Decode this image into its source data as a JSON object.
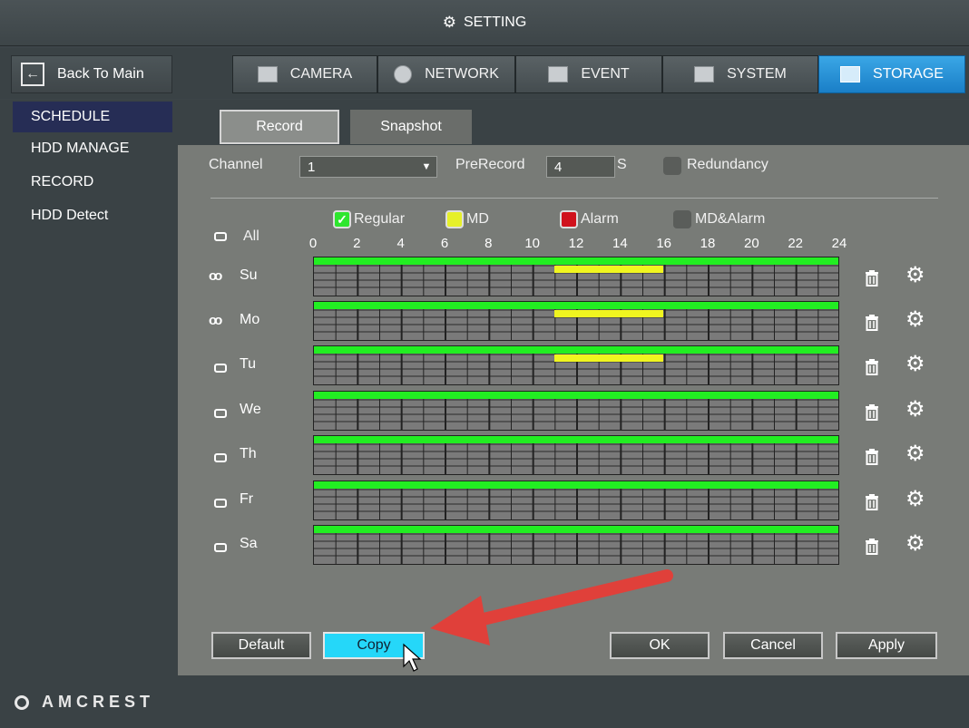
{
  "title": "SETTING",
  "nav": {
    "back_label": "Back To Main",
    "tabs": [
      {
        "label": "CAMERA",
        "icon": "camera-icon"
      },
      {
        "label": "NETWORK",
        "icon": "globe-icon"
      },
      {
        "label": "EVENT",
        "icon": "event-icon"
      },
      {
        "label": "SYSTEM",
        "icon": "system-icon"
      },
      {
        "label": "STORAGE",
        "icon": "monitor-icon",
        "active": true
      }
    ]
  },
  "sidebar": {
    "items": [
      {
        "label": "SCHEDULE",
        "active": true
      },
      {
        "label": "HDD MANAGE"
      },
      {
        "label": "RECORD"
      },
      {
        "label": "HDD Detect"
      }
    ],
    "logo_text": "AMCREST"
  },
  "subtabs": [
    {
      "label": "Record",
      "active": true
    },
    {
      "label": "Snapshot"
    }
  ],
  "form": {
    "channel_label": "Channel",
    "channel_value": "1",
    "prerecord_label": "PreRecord",
    "prerecord_value": "4",
    "prerecord_unit": "S",
    "redundancy_label": "Redundancy",
    "redundancy_checked": false
  },
  "legend": [
    {
      "label": "Regular",
      "color": "#2ee62e",
      "checked": true
    },
    {
      "label": "MD",
      "color": "#e6f02a",
      "checked": false
    },
    {
      "label": "Alarm",
      "color": "#d0111c",
      "checked": false
    },
    {
      "label": "MD&Alarm",
      "color": "#5a5d5a",
      "checked": false
    }
  ],
  "all_label": "All",
  "hour_ticks": [
    "0",
    "2",
    "4",
    "6",
    "8",
    "10",
    "12",
    "14",
    "16",
    "18",
    "20",
    "22",
    "24"
  ],
  "schedule": {
    "days": [
      {
        "label": "Su",
        "linked": true,
        "regular": [
          0,
          24
        ],
        "md": [
          11,
          16
        ]
      },
      {
        "label": "Mo",
        "linked": true,
        "regular": [
          0,
          24
        ],
        "md": [
          11,
          16
        ]
      },
      {
        "label": "Tu",
        "linked": false,
        "regular": [
          0,
          24
        ],
        "md": [
          11,
          16
        ]
      },
      {
        "label": "We",
        "linked": false,
        "regular": [
          0,
          24
        ],
        "md": null
      },
      {
        "label": "Th",
        "linked": false,
        "regular": [
          0,
          24
        ],
        "md": null
      },
      {
        "label": "Fr",
        "linked": false,
        "regular": [
          0,
          24
        ],
        "md": null
      },
      {
        "label": "Sa",
        "linked": false,
        "regular": [
          0,
          24
        ],
        "md": null
      }
    ]
  },
  "buttons": {
    "default": "Default",
    "copy": "Copy",
    "ok": "OK",
    "cancel": "Cancel",
    "apply": "Apply"
  },
  "colors": {
    "accent_blue": "#1a7fc7",
    "copy_highlight": "#25d7f9",
    "annotation_arrow": "#e0403a"
  }
}
